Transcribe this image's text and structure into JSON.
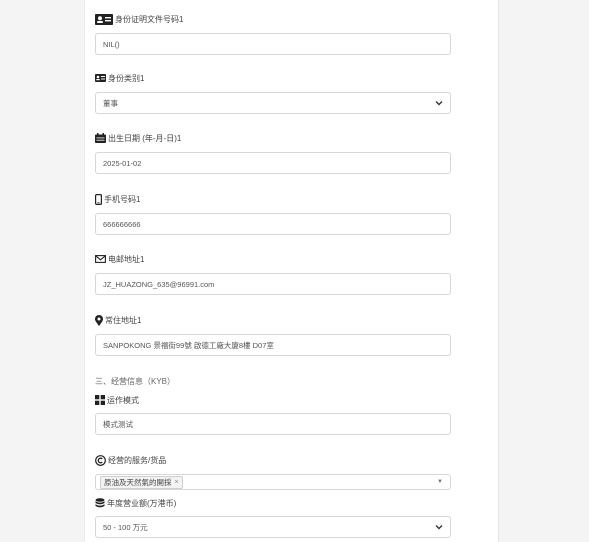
{
  "fields": [
    {
      "label": "身份证明文件号码1",
      "value": "NIL()",
      "type": "input",
      "icon": "id-card-icon"
    },
    {
      "label": "身份类别1",
      "value": "董事",
      "type": "select",
      "icon": "id-badge-icon"
    },
    {
      "label": "出生日期 (年-月-日)1",
      "value": "2025-01-02",
      "type": "input",
      "icon": "calendar-icon"
    },
    {
      "label": "手机号码1",
      "value": "666666666",
      "type": "input",
      "icon": "phone-icon"
    },
    {
      "label": "电邮地址1",
      "value": "JZ_HUAZONG_635@96991.com",
      "type": "input",
      "icon": "envelope-icon"
    },
    {
      "label": "常住地址1",
      "value": "SANPOKONG 景福街99號 啟德工廠大廈8樓 D07室",
      "type": "input",
      "icon": "map-pin-icon"
    }
  ],
  "section_title": "三、经营信息（KYB）",
  "kyb": {
    "mode_label": "运作模式",
    "mode_value": "模式测试",
    "services_label": "经营的服务/货品",
    "services_tag": "原油及天然氣的開採",
    "services_tag_remove": "×",
    "turnover_label": "年度营业额(万港币)",
    "turnover_value": "50 - 100 万元"
  }
}
